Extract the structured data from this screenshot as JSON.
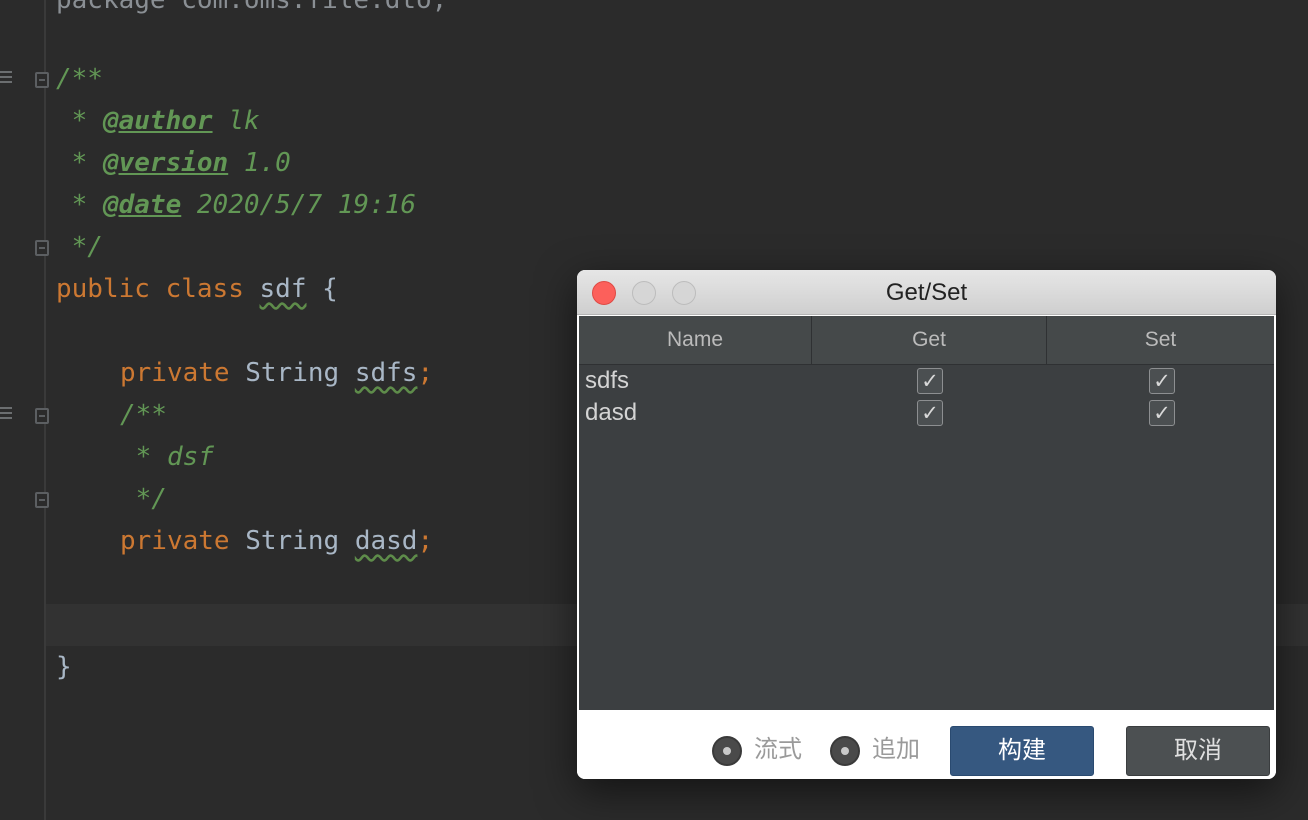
{
  "editor": {
    "lines": {
      "package_line": "package com.oms.file.dto;",
      "javadoc_open": "/**",
      "author_tag": "@author",
      "author_value": " lk",
      "version_tag": "@version",
      "version_value": " 1.0",
      "date_tag": "@date",
      "date_value": " 2020/5/7 19:16",
      "javadoc_close": " */",
      "class_kw1": "public",
      "class_kw2": "class",
      "class_name": "sdf",
      "class_brace": " {",
      "field1_kw": "private",
      "field1_type": " String ",
      "field1_name": "sdfs",
      "field1_semi": ";",
      "doc2_open": "/**",
      "doc2_text": " * dsf",
      "doc2_close": " */",
      "field2_kw": "private",
      "field2_type": " String ",
      "field2_name": "dasd",
      "field2_semi": ";",
      "close_brace": "}"
    },
    "comment_star": " * "
  },
  "dialog": {
    "title": "Get/Set",
    "columns": [
      "Name",
      "Get",
      "Set"
    ],
    "rows": [
      {
        "name": "sdfs",
        "get": true,
        "set": true
      },
      {
        "name": "dasd",
        "get": true,
        "set": true
      }
    ],
    "check_glyph": "✓",
    "options": [
      {
        "label": "流式"
      },
      {
        "label": "追加"
      }
    ],
    "build_label": "构建",
    "cancel_label": "取消"
  },
  "colors": {
    "editor_bg": "#2b2b2b",
    "keyword": "#cc7832",
    "comment": "#629755",
    "primary_button": "#365880"
  }
}
